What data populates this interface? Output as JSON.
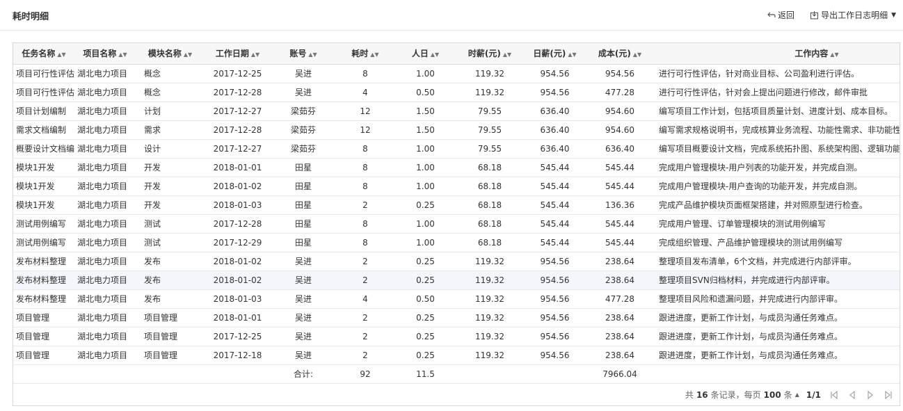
{
  "header": {
    "title": "耗时明细",
    "back_label": "返回",
    "export_label": "导出工作日志明细"
  },
  "table": {
    "columns": [
      {
        "label": "任务名称",
        "sortable": true
      },
      {
        "label": "项目名称",
        "sortable": true
      },
      {
        "label": "模块名称",
        "sortable": true
      },
      {
        "label": "工作日期",
        "sortable": true
      },
      {
        "label": "账号",
        "sortable": true
      },
      {
        "label": "耗时",
        "sortable": true
      },
      {
        "label": "人日",
        "sortable": true
      },
      {
        "label": "时薪(元)",
        "sortable": true
      },
      {
        "label": "日薪(元)",
        "sortable": true
      },
      {
        "label": "成本(元)",
        "sortable": true
      },
      {
        "label": "工作内容",
        "sortable": true
      }
    ],
    "rows": [
      [
        "项目可行性评估",
        "湖北电力项目",
        "概念",
        "2017-12-25",
        "吴进",
        "8",
        "1.00",
        "119.32",
        "954.56",
        "954.56",
        "进行可行性评估，针对商业目标、公司盈利进行评估。"
      ],
      [
        "项目可行性评估",
        "湖北电力项目",
        "概念",
        "2017-12-28",
        "吴进",
        "4",
        "0.50",
        "119.32",
        "954.56",
        "477.28",
        "进行可行性评估，针对会上提出问题进行修改，邮件审批"
      ],
      [
        "项目计划编制",
        "湖北电力项目",
        "计划",
        "2017-12-27",
        "梁茹芬",
        "12",
        "1.50",
        "79.55",
        "636.40",
        "954.60",
        "编写项目工作计划，包括项目质量计划、进度计划、成本目标。"
      ],
      [
        "需求文档编制",
        "湖北电力项目",
        "需求",
        "2017-12-28",
        "梁茹芬",
        "12",
        "1.50",
        "79.55",
        "636.40",
        "954.60",
        "编写需求规格说明书，完成核算业务流程、功能性需求、非功能性需求编"
      ],
      [
        "概要设计文档编",
        "湖北电力项目",
        "设计",
        "2017-12-27",
        "梁茹芬",
        "8",
        "1.00",
        "79.55",
        "636.40",
        "636.40",
        "编写项目概要设计文档，完成系统拓扑图、系统架构图、逻辑功能图。"
      ],
      [
        "模块1开发",
        "湖北电力项目",
        "开发",
        "2018-01-01",
        "田星",
        "8",
        "1.00",
        "68.18",
        "545.44",
        "545.44",
        "完成用户管理模块-用户列表的功能开发，并完成自测。"
      ],
      [
        "模块1开发",
        "湖北电力项目",
        "开发",
        "2018-01-02",
        "田星",
        "8",
        "1.00",
        "68.18",
        "545.44",
        "545.44",
        "完成用户管理模块-用户查询的功能开发，并完成自测。"
      ],
      [
        "模块1开发",
        "湖北电力项目",
        "开发",
        "2018-01-03",
        "田星",
        "2",
        "0.25",
        "68.18",
        "545.44",
        "136.36",
        "完成产品维护模块页面框架搭建，并对照原型进行检查。"
      ],
      [
        "测试用例编写",
        "湖北电力项目",
        "测试",
        "2017-12-28",
        "田星",
        "8",
        "1.00",
        "68.18",
        "545.44",
        "545.44",
        "完成用户管理、订单管理模块的测试用例编写"
      ],
      [
        "测试用例编写",
        "湖北电力项目",
        "测试",
        "2017-12-29",
        "田星",
        "8",
        "1.00",
        "68.18",
        "545.44",
        "545.44",
        "完成组织管理、产品维护管理模块的测试用例编写"
      ],
      [
        "发布材料整理",
        "湖北电力项目",
        "发布",
        "2018-01-02",
        "吴进",
        "2",
        "0.25",
        "119.32",
        "954.56",
        "238.64",
        "整理项目发布清单，6个文档，并完成进行内部评审。"
      ],
      [
        "发布材料整理",
        "湖北电力项目",
        "发布",
        "2018-01-02",
        "吴进",
        "2",
        "0.25",
        "119.32",
        "954.56",
        "238.64",
        "整理项目SVN归档材料，并完成进行内部评审。"
      ],
      [
        "发布材料整理",
        "湖北电力项目",
        "发布",
        "2018-01-03",
        "吴进",
        "4",
        "0.50",
        "119.32",
        "954.56",
        "477.28",
        "整理项目风险和遗漏问题，并完成进行内部评审。"
      ],
      [
        "项目管理",
        "湖北电力项目",
        "项目管理",
        "2018-01-01",
        "吴进",
        "2",
        "0.25",
        "119.32",
        "954.56",
        "238.64",
        "跟进进度，更新工作计划，与成员沟通任务难点。"
      ],
      [
        "项目管理",
        "湖北电力项目",
        "项目管理",
        "2017-12-25",
        "吴进",
        "2",
        "0.25",
        "119.32",
        "954.56",
        "238.64",
        "跟进进度，更新工作计划，与成员沟通任务难点。"
      ],
      [
        "项目管理",
        "湖北电力项目",
        "项目管理",
        "2017-12-18",
        "吴进",
        "2",
        "0.25",
        "119.32",
        "954.56",
        "238.64",
        "跟进进度，更新工作计划，与成员沟通任务难点。"
      ]
    ],
    "totals": {
      "label": "合计:",
      "hours": "92",
      "person_days": "11.5",
      "cost": "7966.04"
    }
  },
  "pager": {
    "total_prefix": "共",
    "total_count": "16",
    "total_suffix": "条记录，每页",
    "page_size": "100",
    "page_size_suffix": "条",
    "page_info": "1/1"
  }
}
